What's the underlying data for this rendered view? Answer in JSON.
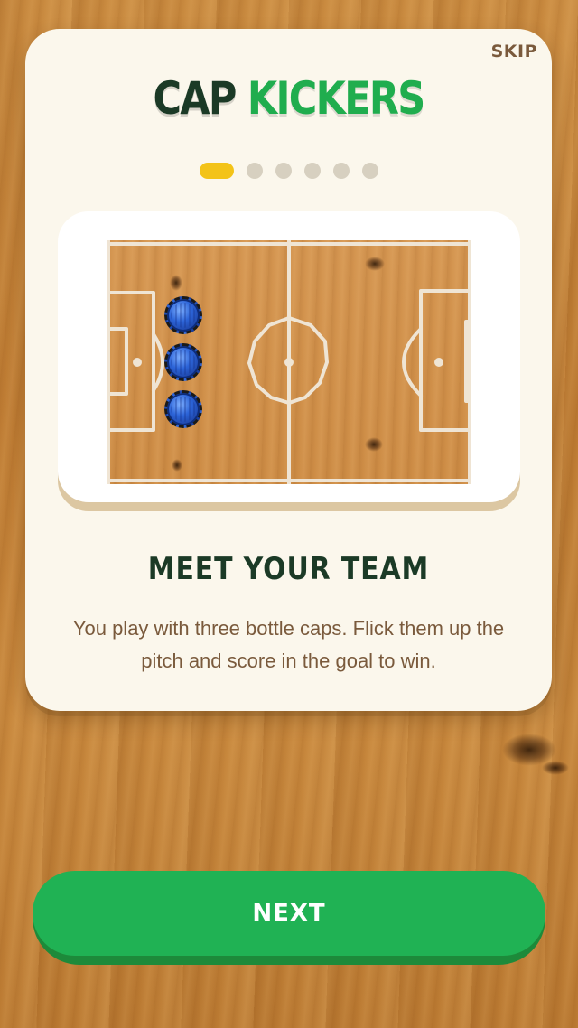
{
  "header": {
    "skip_label": "SKIP"
  },
  "title": {
    "word1": "CAP",
    "word2": "KICKERS"
  },
  "pagination": {
    "total": 6,
    "current": 1
  },
  "illustration": {
    "caps": [
      {
        "name": "blue-cap-1"
      },
      {
        "name": "blue-cap-2"
      },
      {
        "name": "blue-cap-3"
      }
    ],
    "colors": {
      "cap": "#2c64d8",
      "pitch": "#cd8c45",
      "lines": "#f2ece0"
    }
  },
  "step": {
    "heading": "MEET YOUR TEAM",
    "description": "You play with three bottle caps. Flick them up the pitch and score in the goal to win."
  },
  "footer": {
    "next_label": "NEXT"
  },
  "colors": {
    "accent": "#20b254",
    "title_dark": "#1b3a26",
    "dot_active": "#f3c318"
  }
}
